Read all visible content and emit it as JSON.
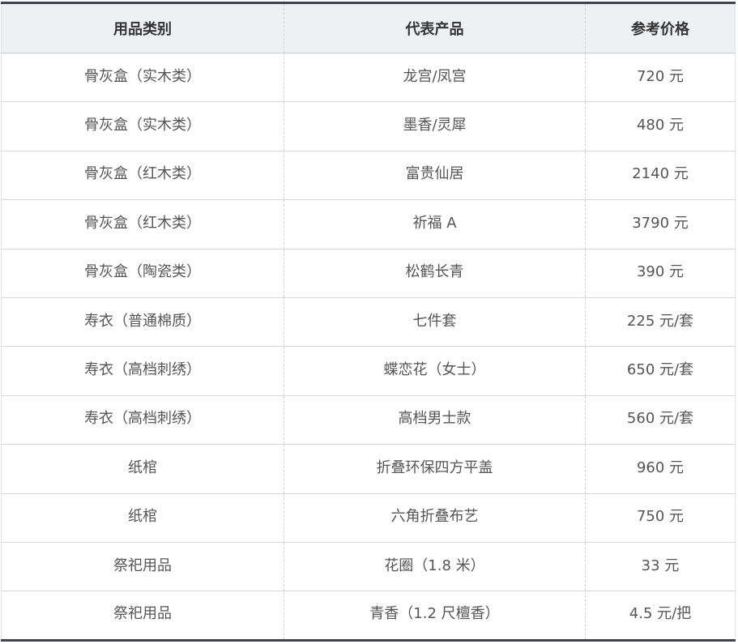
{
  "table": {
    "headers": [
      "用品类别",
      "代表产品",
      "参考价格"
    ],
    "rows": [
      [
        "骨灰盒（实木类）",
        "龙宫/凤宫",
        "720 元"
      ],
      [
        "骨灰盒（实木类）",
        "墨香/灵犀",
        "480 元"
      ],
      [
        "骨灰盒（红木类）",
        "富贵仙居",
        "2140 元"
      ],
      [
        "骨灰盒（红木类）",
        "祈福 A",
        "3790 元"
      ],
      [
        "骨灰盒（陶瓷类）",
        "松鹤长青",
        "390 元"
      ],
      [
        "寿衣（普通棉质）",
        "七件套",
        "225 元/套"
      ],
      [
        "寿衣（高档刺绣）",
        "蝶恋花（女士）",
        "650 元/套"
      ],
      [
        "寿衣（高档刺绣）",
        "高档男士款",
        "560 元/套"
      ],
      [
        "纸棺",
        "折叠环保四方平盖",
        "960 元"
      ],
      [
        "纸棺",
        "六角折叠布艺",
        "750 元"
      ],
      [
        "祭祀用品",
        "花圈（1.8 米）",
        "33 元"
      ],
      [
        "祭祀用品",
        "青香（1.2 尺檀香）",
        "4.5 元/把"
      ]
    ]
  }
}
